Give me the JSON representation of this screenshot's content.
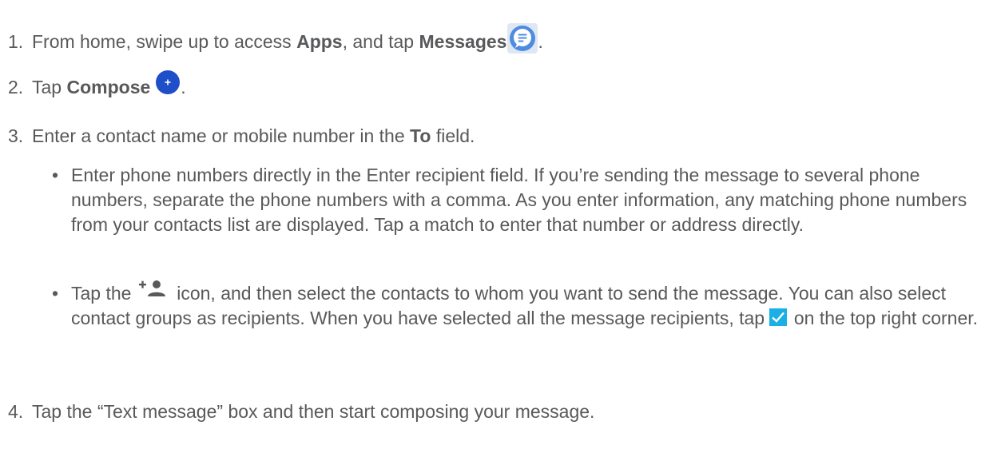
{
  "steps": [
    {
      "number": "1.",
      "pre": "From home, swipe up to access ",
      "bold1": "Apps",
      "mid": ", and tap ",
      "bold2": "Messages",
      "post": "."
    },
    {
      "number": "2.",
      "pre": "Tap ",
      "bold1": "Compose",
      "post": "."
    },
    {
      "number": "3.",
      "pre": "Enter a contact name or mobile number in the ",
      "bold1": "To",
      "post": " field."
    },
    {
      "number": "4.",
      "text": "Tap the “Text message” box and then start composing your message."
    }
  ],
  "bullets": [
    {
      "dot": "•",
      "text": "Enter phone numbers directly in the Enter recipient field. If you’re sending the message to several phone numbers, separate the phone numbers with a comma. As you enter information, any matching phone numbers from your contacts list are displayed. Tap a match to enter that number or address directly."
    },
    {
      "dot": "•",
      "pre": "Tap the ",
      "mid": " icon, and then select the contacts to whom you want to send the message. You can also select contact groups as recipients. When you have selected all the message recipients, tap ",
      "post": " on the top right corner."
    }
  ],
  "icons": {
    "messages": "messages-app-icon",
    "compose": "compose-plus-icon",
    "add_contact": "add-contact-icon",
    "checkbox": "checkbox-checked-icon"
  },
  "colors": {
    "text": "#58595b",
    "messages_blue": "#4e8ce0",
    "compose_blue": "#1f4fc8",
    "check_blue": "#1ab0e6"
  }
}
